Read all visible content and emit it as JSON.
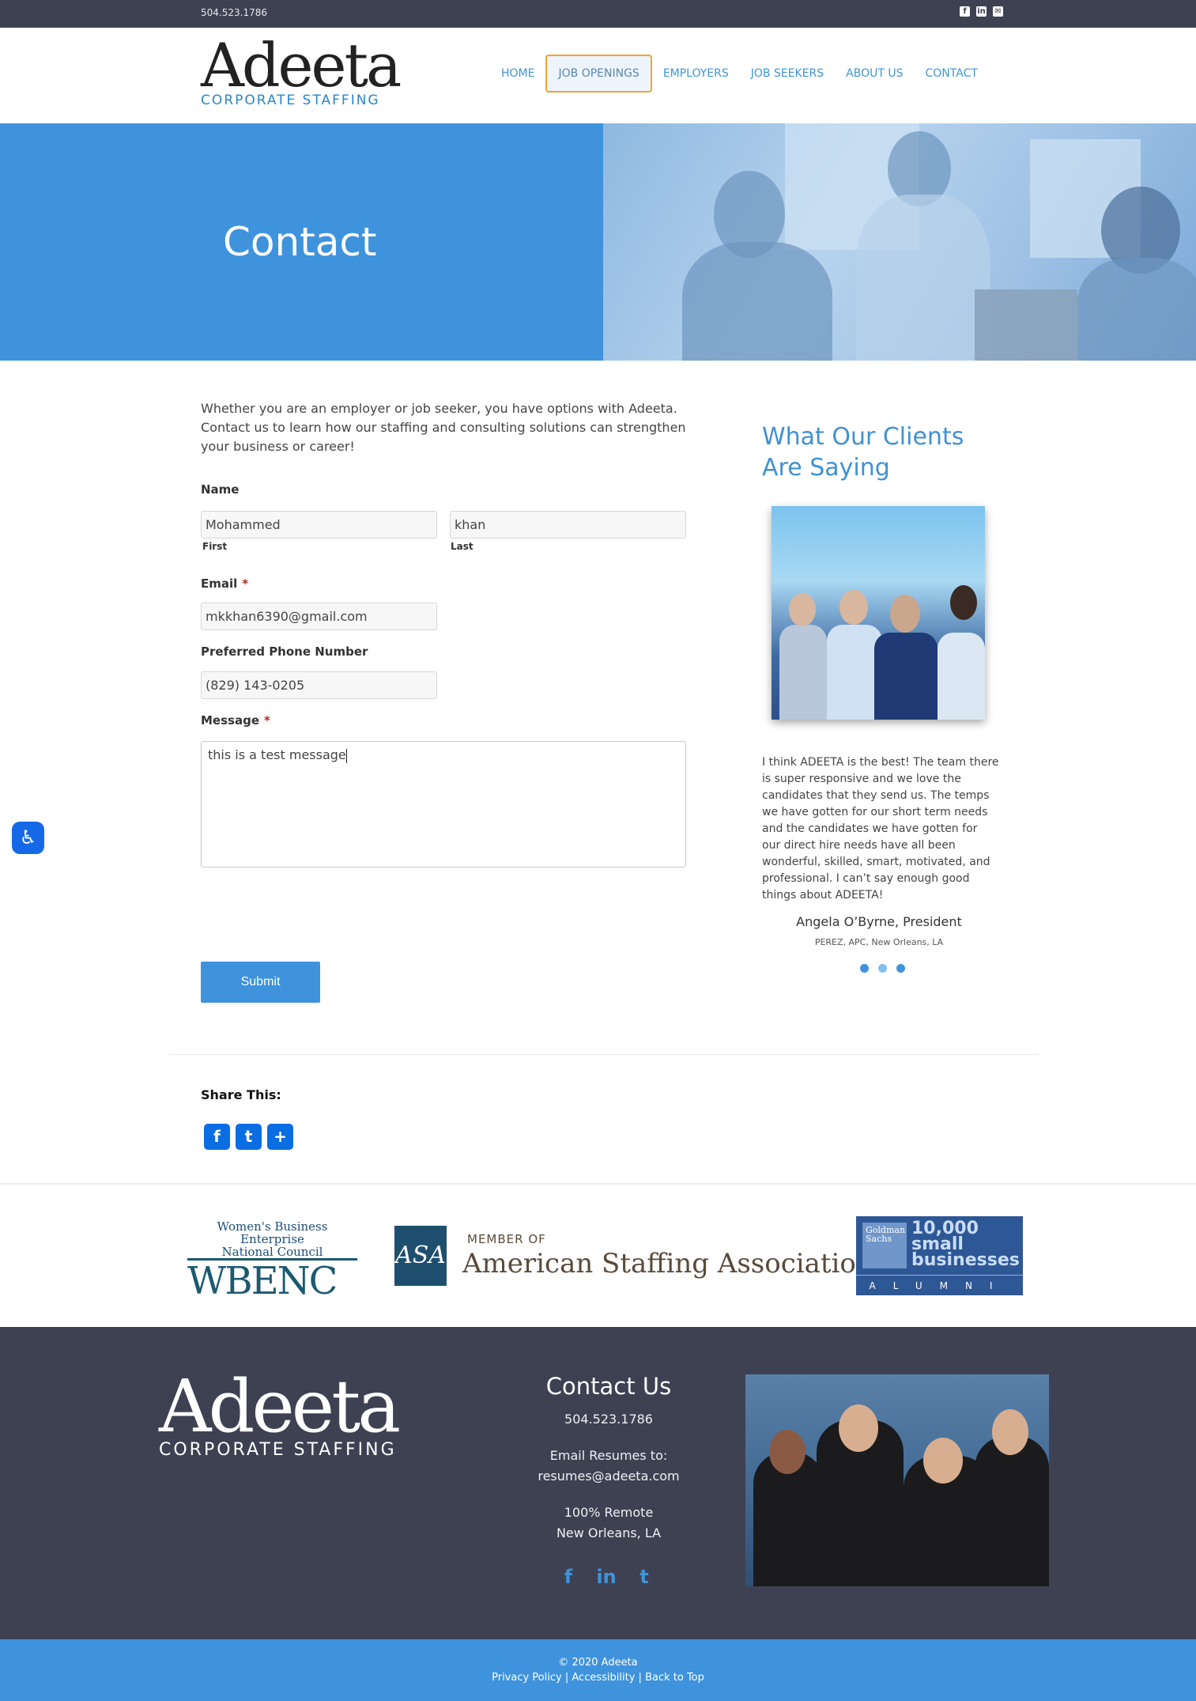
{
  "topbar": {
    "phone": "504.523.1786",
    "social": [
      "facebook-icon",
      "linkedin-icon",
      "email-icon"
    ]
  },
  "brand": {
    "name": "Adeeta",
    "tagline": "CORPORATE STAFFING"
  },
  "nav": {
    "items": [
      "HOME",
      "JOB OPENINGS",
      "EMPLOYERS",
      "JOB SEEKERS",
      "ABOUT US",
      "CONTACT"
    ],
    "active": "JOB OPENINGS"
  },
  "hero": {
    "title": "Contact"
  },
  "form": {
    "intro": "Whether you are an employer or job seeker, you have options with Adeeta. Contact us to learn how our staffing and consulting solutions can strengthen your business or career!",
    "name_label": "Name",
    "first_value": "Mohammed",
    "first_sublabel": "First",
    "last_value": "khan",
    "last_sublabel": "Last",
    "email_label": "Email",
    "email_value": "mkkhan6390@gmail.com",
    "phone_label": "Preferred Phone Number",
    "phone_value": "(829) 143-0205",
    "message_label": "Message",
    "message_value": "this is a test message",
    "required_mark": "*",
    "submit_label": "Submit"
  },
  "testimonials": {
    "heading_line1": "What Our Clients",
    "heading_line2": "Are Saying",
    "quote": "I think ADEETA is the best! The team there is super responsive and we love the candidates that they send us. The temps we have gotten for our short term needs and the candidates we have gotten for our direct hire needs have all been wonderful, skilled, smart, motivated, and professional. I can’t say enough good things about ADEETA!",
    "author": "Angela O’Byrne, President",
    "org": "PEREZ, APC, New Orleans, LA",
    "dots": 3,
    "active_dot": 2
  },
  "share": {
    "label": "Share This:",
    "icons": [
      "facebook-icon",
      "twitter-icon",
      "share-plus-icon"
    ]
  },
  "partners": {
    "wbenc_line1": "Women's Business Enterprise",
    "wbenc_line2": "National Council",
    "wbenc_big": "WBENC",
    "asa_box": "ASA",
    "asa_member": "MEMBER OF",
    "asa_name": "American Staffing Association",
    "gs_box": "Goldman Sachs",
    "gs_num1": "10,000",
    "gs_num2": "small",
    "gs_num3": "businesses",
    "gs_alumni": "ALUMNI"
  },
  "footer": {
    "heading": "Contact Us",
    "phone": "504.523.1786",
    "email_label": "Email Resumes to:",
    "email": "resumes@adeeta.com",
    "remote": "100% Remote",
    "location": "New Orleans, LA",
    "social": [
      "facebook-icon",
      "linkedin-icon",
      "twitter-icon"
    ]
  },
  "bottombar": {
    "copyright": "© 2020 Adeeta",
    "links": [
      "Privacy Policy",
      "Accessibility",
      "Back to Top"
    ],
    "separator": "|"
  },
  "colors": {
    "accent": "#3e93dc",
    "dark": "#3e4152",
    "nav_highlight": "#f0a732"
  }
}
